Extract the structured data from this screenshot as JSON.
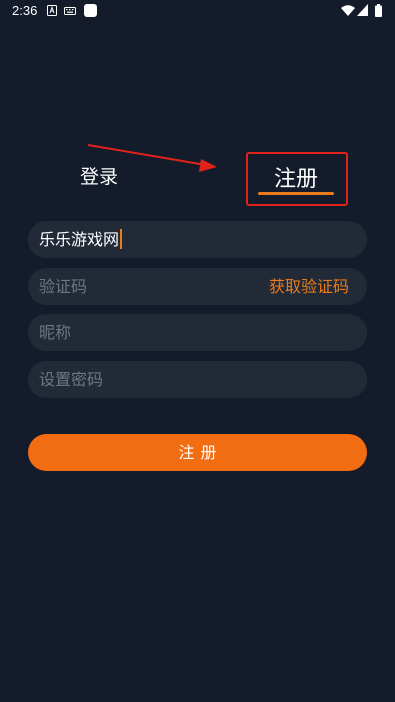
{
  "status_bar": {
    "time": "2:36"
  },
  "tabs": {
    "login_label": "登录",
    "register_label": "注册"
  },
  "form": {
    "username_value": "乐乐游戏网",
    "code_placeholder": "验证码",
    "get_code_label": "获取验证码",
    "nickname_placeholder": "昵称",
    "password_placeholder": "设置密码"
  },
  "submit": {
    "label": "注册"
  },
  "colors": {
    "background": "#141b2b",
    "field_background": "#222a38",
    "accent": "#e97b1b",
    "button": "#f26c12",
    "annotation_red": "#e2231a"
  },
  "icons": [
    "a-notification-icon",
    "keyboard-icon",
    "app-icon",
    "wifi-icon",
    "signal-icon",
    "battery-icon"
  ]
}
